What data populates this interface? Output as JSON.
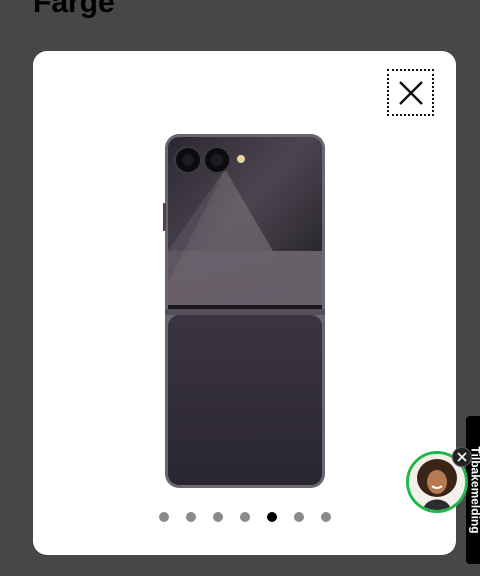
{
  "page": {
    "heading": "Farge"
  },
  "modal": {
    "close_icon": "close-icon",
    "product_image": "phone-image",
    "carousel": {
      "total": 7,
      "active_index": 4
    }
  },
  "feedback": {
    "label": "Tilbakemelding"
  },
  "chat": {
    "avatar_icon": "chat-agent-avatar",
    "close_icon": "close-icon"
  },
  "colors": {
    "page_background": "#474747",
    "modal_background": "#ffffff",
    "dot_inactive": "#8a8a8a",
    "dot_active": "#000000",
    "chat_ring": "#1fb84a"
  }
}
